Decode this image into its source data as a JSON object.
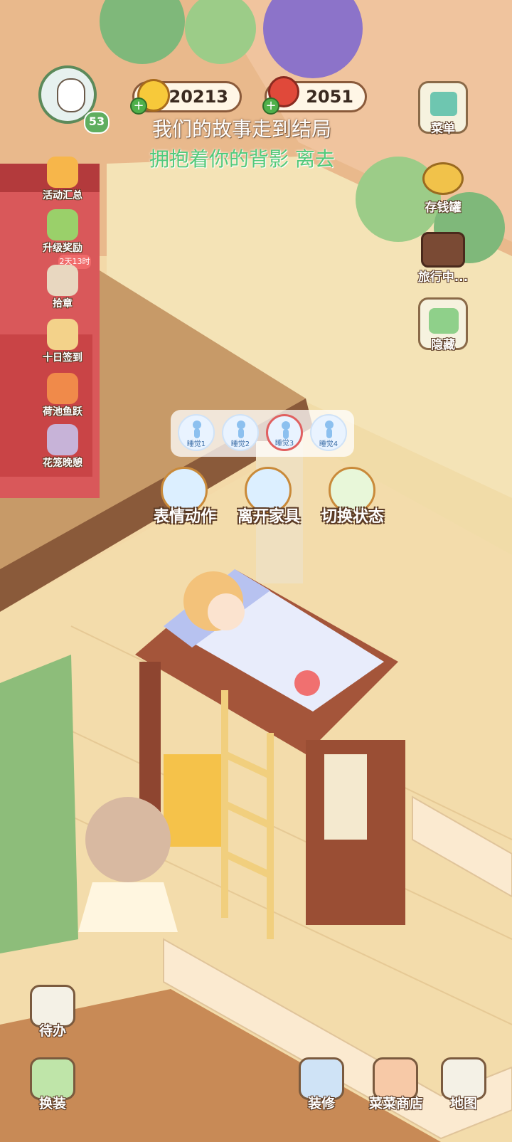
{
  "player": {
    "level": "53"
  },
  "currency": {
    "coins": "20213",
    "food": "2051"
  },
  "lyrics": {
    "line1": "我们的故事走到结局",
    "line2": "拥抱着你的背影 离去"
  },
  "right_menu": [
    {
      "label": "菜单",
      "icon": "menu-icon"
    },
    {
      "label": "存钱罐",
      "icon": "piggy-bank-icon"
    },
    {
      "label": "旅行中...",
      "icon": "camera-icon"
    },
    {
      "label": "隐藏",
      "icon": "hide-icon"
    }
  ],
  "left_menu": [
    {
      "label": "活动汇总",
      "icon": "events-icon"
    },
    {
      "label": "升级奖励",
      "icon": "level-reward-icon"
    },
    {
      "label": "拾章",
      "icon": "chapter-icon"
    },
    {
      "label": "十日签到",
      "icon": "checkin-icon"
    },
    {
      "label": "荷池鱼跃",
      "icon": "koi-icon"
    },
    {
      "label": "花笼晚憩",
      "icon": "flower-cage-icon"
    }
  ],
  "timer_badge": "2天13时",
  "sleep_poses": [
    "睡觉1",
    "睡觉2",
    "睡觉3",
    "睡觉4"
  ],
  "selected_pose_index": 2,
  "actions": {
    "emote": "表情动作",
    "leave": "离开家具",
    "switch": "切换状态"
  },
  "bottom_left": {
    "todo": "待办",
    "dressup": "换装"
  },
  "bottom_bar": {
    "decorate": "装修",
    "shop": "菜菜商店",
    "map": "地图"
  },
  "colors": {
    "accent_green": "#52c97a",
    "floor": "#f3dcab",
    "wall": "#f4e3b6"
  }
}
